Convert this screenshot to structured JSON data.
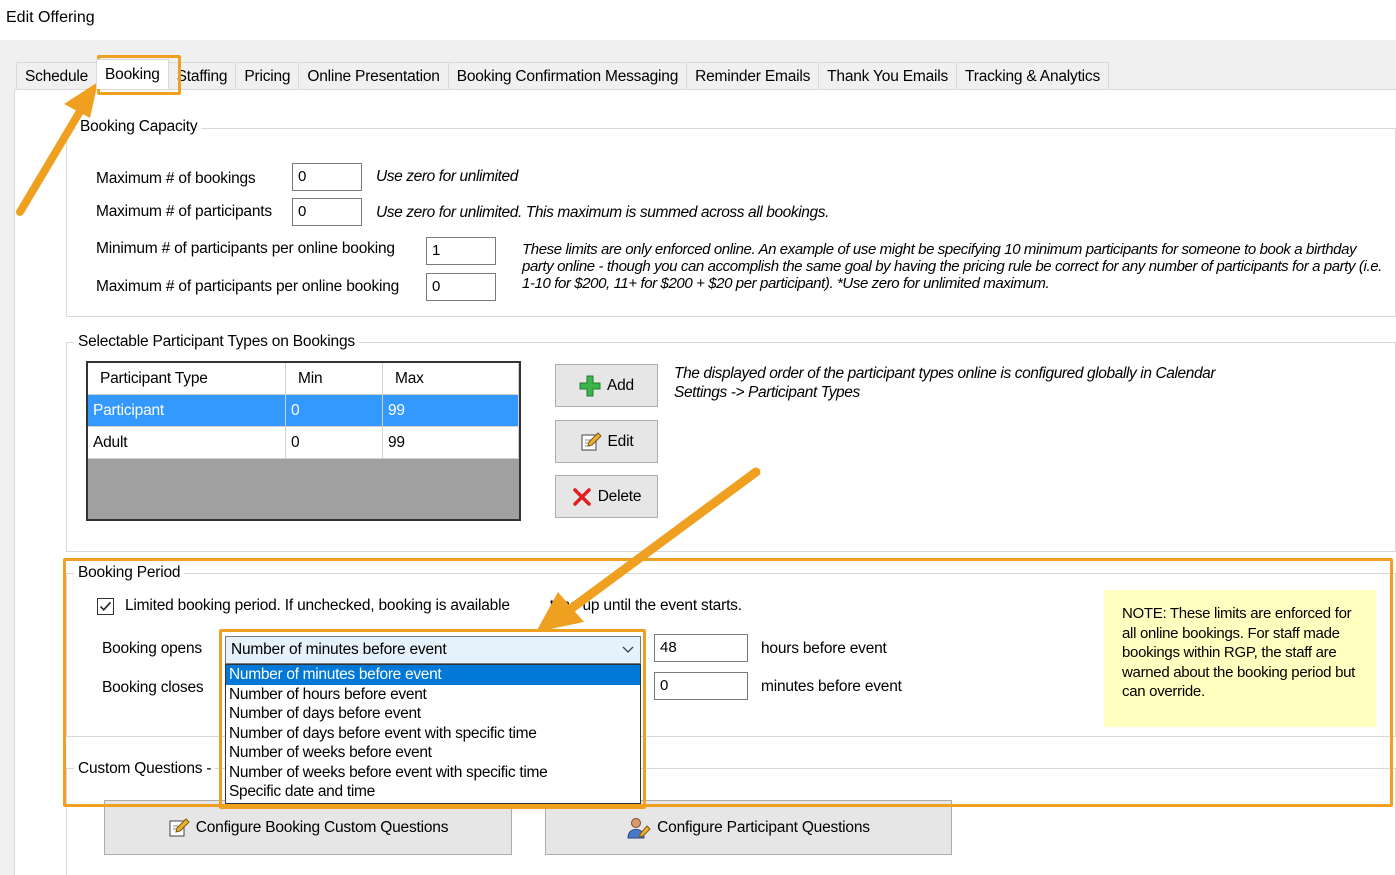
{
  "window": {
    "title": "Edit Offering"
  },
  "tabs": [
    "Schedule",
    "Booking",
    "Staffing",
    "Pricing",
    "Online Presentation",
    "Booking Confirmation Messaging",
    "Reminder Emails",
    "Thank You Emails",
    "Tracking & Analytics"
  ],
  "booking_capacity": {
    "legend": "Booking Capacity",
    "max_bookings_label": "Maximum # of bookings",
    "max_bookings_value": "0",
    "max_bookings_hint": "Use zero for unlimited",
    "max_participants_label": "Maximum # of participants",
    "max_participants_value": "0",
    "max_participants_hint": "Use zero for unlimited.  This maximum is summed across all bookings.",
    "min_per_online_label": "Minimum # of participants per online booking",
    "min_per_online_value": "1",
    "max_per_online_label": "Maximum # of participants per online booking",
    "max_per_online_value": "0",
    "limits_hint": "These limits are only enforced online.  An example of use might be specifying 10 minimum participants for someone to book a birthday party online - though you can accomplish the same goal by having the pricing rule be correct for any number of participants for a party (i.e. 1-10 for $200, 11+ for $200 + $20 per participant).  *Use zero for unlimited maximum."
  },
  "participant_types": {
    "legend": "Selectable Participant Types on Bookings",
    "columns": [
      "Participant Type",
      "Min",
      "Max"
    ],
    "rows": [
      {
        "type": "Participant",
        "min": "0",
        "max": "99"
      },
      {
        "type": "Adult",
        "min": "0",
        "max": "99"
      }
    ],
    "add_label": "Add",
    "edit_label": "Edit",
    "delete_label": "Delete",
    "order_hint": "The displayed order of the participant types online is configured globally in Calendar Settings -> Participant Types"
  },
  "booking_period": {
    "legend": "Booking Period",
    "limited_label_before": "Limited booking period.  If unchecked, booking is available",
    "limited_label_after": "time up until the event starts.",
    "opens_label": "Booking opens",
    "opens_selected": "Number of minutes before event",
    "opens_value": "48",
    "opens_unit": "hours before event",
    "closes_label": "Booking closes",
    "closes_value": "0",
    "closes_unit": "minutes before event",
    "options": [
      "Number of minutes before event",
      "Number of hours before event",
      "Number of days before event",
      "Number of days before event with specific time",
      "Number of weeks before event",
      "Number of weeks before event with specific time",
      "Specific date and time"
    ],
    "note": "NOTE:  These limits are enforced for all online bookings. For staff made bookings within RGP, the staff are warned about the booking period but can override."
  },
  "custom_questions": {
    "legend": "Custom Questions -",
    "configure_booking_label": "Configure Booking Custom Questions",
    "configure_participant_label": "Configure Participant Questions"
  },
  "colors": {
    "highlight": "#f0a020",
    "selection": "#3399ff"
  }
}
